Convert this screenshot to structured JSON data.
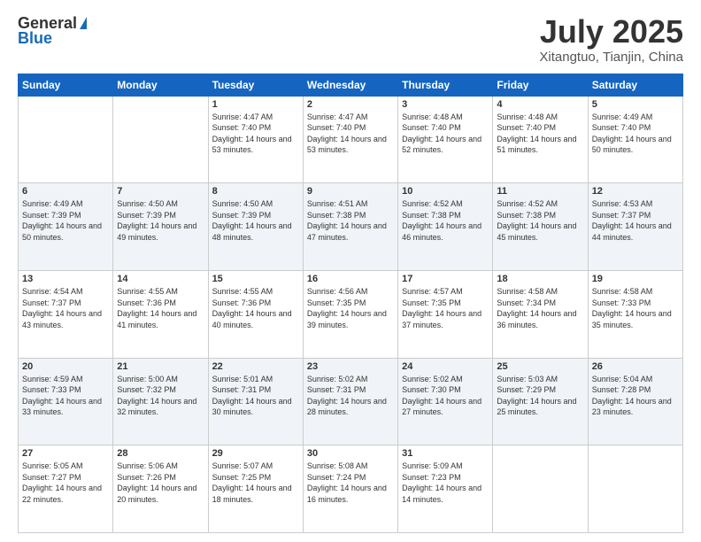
{
  "logo": {
    "general": "General",
    "blue": "Blue"
  },
  "title": {
    "month": "July 2025",
    "location": "Xitangtuo, Tianjin, China"
  },
  "days_of_week": [
    "Sunday",
    "Monday",
    "Tuesday",
    "Wednesday",
    "Thursday",
    "Friday",
    "Saturday"
  ],
  "weeks": [
    [
      {
        "day": "",
        "sunrise": "",
        "sunset": "",
        "daylight": ""
      },
      {
        "day": "",
        "sunrise": "",
        "sunset": "",
        "daylight": ""
      },
      {
        "day": "1",
        "sunrise": "Sunrise: 4:47 AM",
        "sunset": "Sunset: 7:40 PM",
        "daylight": "Daylight: 14 hours and 53 minutes."
      },
      {
        "day": "2",
        "sunrise": "Sunrise: 4:47 AM",
        "sunset": "Sunset: 7:40 PM",
        "daylight": "Daylight: 14 hours and 53 minutes."
      },
      {
        "day": "3",
        "sunrise": "Sunrise: 4:48 AM",
        "sunset": "Sunset: 7:40 PM",
        "daylight": "Daylight: 14 hours and 52 minutes."
      },
      {
        "day": "4",
        "sunrise": "Sunrise: 4:48 AM",
        "sunset": "Sunset: 7:40 PM",
        "daylight": "Daylight: 14 hours and 51 minutes."
      },
      {
        "day": "5",
        "sunrise": "Sunrise: 4:49 AM",
        "sunset": "Sunset: 7:40 PM",
        "daylight": "Daylight: 14 hours and 50 minutes."
      }
    ],
    [
      {
        "day": "6",
        "sunrise": "Sunrise: 4:49 AM",
        "sunset": "Sunset: 7:39 PM",
        "daylight": "Daylight: 14 hours and 50 minutes."
      },
      {
        "day": "7",
        "sunrise": "Sunrise: 4:50 AM",
        "sunset": "Sunset: 7:39 PM",
        "daylight": "Daylight: 14 hours and 49 minutes."
      },
      {
        "day": "8",
        "sunrise": "Sunrise: 4:50 AM",
        "sunset": "Sunset: 7:39 PM",
        "daylight": "Daylight: 14 hours and 48 minutes."
      },
      {
        "day": "9",
        "sunrise": "Sunrise: 4:51 AM",
        "sunset": "Sunset: 7:38 PM",
        "daylight": "Daylight: 14 hours and 47 minutes."
      },
      {
        "day": "10",
        "sunrise": "Sunrise: 4:52 AM",
        "sunset": "Sunset: 7:38 PM",
        "daylight": "Daylight: 14 hours and 46 minutes."
      },
      {
        "day": "11",
        "sunrise": "Sunrise: 4:52 AM",
        "sunset": "Sunset: 7:38 PM",
        "daylight": "Daylight: 14 hours and 45 minutes."
      },
      {
        "day": "12",
        "sunrise": "Sunrise: 4:53 AM",
        "sunset": "Sunset: 7:37 PM",
        "daylight": "Daylight: 14 hours and 44 minutes."
      }
    ],
    [
      {
        "day": "13",
        "sunrise": "Sunrise: 4:54 AM",
        "sunset": "Sunset: 7:37 PM",
        "daylight": "Daylight: 14 hours and 43 minutes."
      },
      {
        "day": "14",
        "sunrise": "Sunrise: 4:55 AM",
        "sunset": "Sunset: 7:36 PM",
        "daylight": "Daylight: 14 hours and 41 minutes."
      },
      {
        "day": "15",
        "sunrise": "Sunrise: 4:55 AM",
        "sunset": "Sunset: 7:36 PM",
        "daylight": "Daylight: 14 hours and 40 minutes."
      },
      {
        "day": "16",
        "sunrise": "Sunrise: 4:56 AM",
        "sunset": "Sunset: 7:35 PM",
        "daylight": "Daylight: 14 hours and 39 minutes."
      },
      {
        "day": "17",
        "sunrise": "Sunrise: 4:57 AM",
        "sunset": "Sunset: 7:35 PM",
        "daylight": "Daylight: 14 hours and 37 minutes."
      },
      {
        "day": "18",
        "sunrise": "Sunrise: 4:58 AM",
        "sunset": "Sunset: 7:34 PM",
        "daylight": "Daylight: 14 hours and 36 minutes."
      },
      {
        "day": "19",
        "sunrise": "Sunrise: 4:58 AM",
        "sunset": "Sunset: 7:33 PM",
        "daylight": "Daylight: 14 hours and 35 minutes."
      }
    ],
    [
      {
        "day": "20",
        "sunrise": "Sunrise: 4:59 AM",
        "sunset": "Sunset: 7:33 PM",
        "daylight": "Daylight: 14 hours and 33 minutes."
      },
      {
        "day": "21",
        "sunrise": "Sunrise: 5:00 AM",
        "sunset": "Sunset: 7:32 PM",
        "daylight": "Daylight: 14 hours and 32 minutes."
      },
      {
        "day": "22",
        "sunrise": "Sunrise: 5:01 AM",
        "sunset": "Sunset: 7:31 PM",
        "daylight": "Daylight: 14 hours and 30 minutes."
      },
      {
        "day": "23",
        "sunrise": "Sunrise: 5:02 AM",
        "sunset": "Sunset: 7:31 PM",
        "daylight": "Daylight: 14 hours and 28 minutes."
      },
      {
        "day": "24",
        "sunrise": "Sunrise: 5:02 AM",
        "sunset": "Sunset: 7:30 PM",
        "daylight": "Daylight: 14 hours and 27 minutes."
      },
      {
        "day": "25",
        "sunrise": "Sunrise: 5:03 AM",
        "sunset": "Sunset: 7:29 PM",
        "daylight": "Daylight: 14 hours and 25 minutes."
      },
      {
        "day": "26",
        "sunrise": "Sunrise: 5:04 AM",
        "sunset": "Sunset: 7:28 PM",
        "daylight": "Daylight: 14 hours and 23 minutes."
      }
    ],
    [
      {
        "day": "27",
        "sunrise": "Sunrise: 5:05 AM",
        "sunset": "Sunset: 7:27 PM",
        "daylight": "Daylight: 14 hours and 22 minutes."
      },
      {
        "day": "28",
        "sunrise": "Sunrise: 5:06 AM",
        "sunset": "Sunset: 7:26 PM",
        "daylight": "Daylight: 14 hours and 20 minutes."
      },
      {
        "day": "29",
        "sunrise": "Sunrise: 5:07 AM",
        "sunset": "Sunset: 7:25 PM",
        "daylight": "Daylight: 14 hours and 18 minutes."
      },
      {
        "day": "30",
        "sunrise": "Sunrise: 5:08 AM",
        "sunset": "Sunset: 7:24 PM",
        "daylight": "Daylight: 14 hours and 16 minutes."
      },
      {
        "day": "31",
        "sunrise": "Sunrise: 5:09 AM",
        "sunset": "Sunset: 7:23 PM",
        "daylight": "Daylight: 14 hours and 14 minutes."
      },
      {
        "day": "",
        "sunrise": "",
        "sunset": "",
        "daylight": ""
      },
      {
        "day": "",
        "sunrise": "",
        "sunset": "",
        "daylight": ""
      }
    ]
  ]
}
